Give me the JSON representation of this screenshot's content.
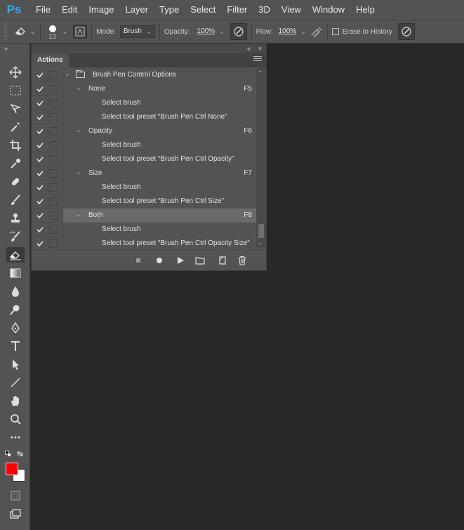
{
  "app": {
    "logo": "Ps"
  },
  "menu": [
    "File",
    "Edit",
    "Image",
    "Layer",
    "Type",
    "Select",
    "Filter",
    "3D",
    "View",
    "Window",
    "Help"
  ],
  "options": {
    "tool_icon": "eraser-icon",
    "brush_size": "13",
    "mode_label": "Mode:",
    "mode_value": "Brush",
    "opacity_label": "Opacity:",
    "opacity_value": "100%",
    "flow_label": "Flow:",
    "flow_value": "100%",
    "erase_history_label": "Erase to History"
  },
  "panel": {
    "tab": "Actions",
    "collapse_glyph": "«",
    "close_glyph": "×",
    "rows": [
      {
        "type": "set",
        "label": "Brush Pen Control Options",
        "key": "",
        "checked": true
      },
      {
        "type": "action",
        "label": "None",
        "key": "F5",
        "checked": true
      },
      {
        "type": "command",
        "label": "Select brush",
        "key": "",
        "checked": true
      },
      {
        "type": "command",
        "label": "Select tool preset “Brush Pen Ctrl None”",
        "key": "",
        "checked": true
      },
      {
        "type": "action",
        "label": "Opacity",
        "key": "F6",
        "checked": true
      },
      {
        "type": "command",
        "label": "Select brush",
        "key": "",
        "checked": true
      },
      {
        "type": "command",
        "label": "Select tool preset “Brush Pen Ctrl Opacity”",
        "key": "",
        "checked": true
      },
      {
        "type": "action",
        "label": "Size",
        "key": "F7",
        "checked": true
      },
      {
        "type": "command",
        "label": "Select brush",
        "key": "",
        "checked": true
      },
      {
        "type": "command",
        "label": "Select tool preset “Brush Pen Ctrl Size”",
        "key": "",
        "checked": true
      },
      {
        "type": "action",
        "label": "Both",
        "key": "F8",
        "checked": true,
        "selected": true
      },
      {
        "type": "command",
        "label": "Select brush",
        "key": "",
        "checked": true
      },
      {
        "type": "command",
        "label": "Select tool preset “Brush Pen Ctrl Opacity Size”",
        "key": "",
        "checked": true
      }
    ]
  },
  "colors": {
    "foreground": "#ff0000",
    "background": "#ffffff",
    "accent": "#31a8ff"
  }
}
